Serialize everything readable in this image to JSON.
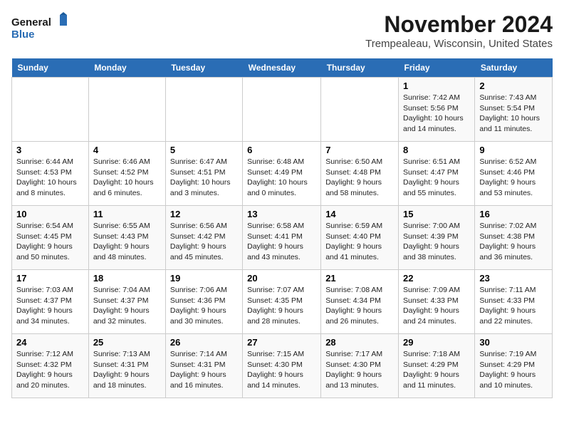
{
  "logo": {
    "line1": "General",
    "line2": "Blue"
  },
  "title": "November 2024",
  "location": "Trempealeau, Wisconsin, United States",
  "days_of_week": [
    "Sunday",
    "Monday",
    "Tuesday",
    "Wednesday",
    "Thursday",
    "Friday",
    "Saturday"
  ],
  "weeks": [
    [
      {
        "day": "",
        "info": ""
      },
      {
        "day": "",
        "info": ""
      },
      {
        "day": "",
        "info": ""
      },
      {
        "day": "",
        "info": ""
      },
      {
        "day": "",
        "info": ""
      },
      {
        "day": "1",
        "info": "Sunrise: 7:42 AM\nSunset: 5:56 PM\nDaylight: 10 hours and 14 minutes."
      },
      {
        "day": "2",
        "info": "Sunrise: 7:43 AM\nSunset: 5:54 PM\nDaylight: 10 hours and 11 minutes."
      }
    ],
    [
      {
        "day": "3",
        "info": "Sunrise: 6:44 AM\nSunset: 4:53 PM\nDaylight: 10 hours and 8 minutes."
      },
      {
        "day": "4",
        "info": "Sunrise: 6:46 AM\nSunset: 4:52 PM\nDaylight: 10 hours and 6 minutes."
      },
      {
        "day": "5",
        "info": "Sunrise: 6:47 AM\nSunset: 4:51 PM\nDaylight: 10 hours and 3 minutes."
      },
      {
        "day": "6",
        "info": "Sunrise: 6:48 AM\nSunset: 4:49 PM\nDaylight: 10 hours and 0 minutes."
      },
      {
        "day": "7",
        "info": "Sunrise: 6:50 AM\nSunset: 4:48 PM\nDaylight: 9 hours and 58 minutes."
      },
      {
        "day": "8",
        "info": "Sunrise: 6:51 AM\nSunset: 4:47 PM\nDaylight: 9 hours and 55 minutes."
      },
      {
        "day": "9",
        "info": "Sunrise: 6:52 AM\nSunset: 4:46 PM\nDaylight: 9 hours and 53 minutes."
      }
    ],
    [
      {
        "day": "10",
        "info": "Sunrise: 6:54 AM\nSunset: 4:45 PM\nDaylight: 9 hours and 50 minutes."
      },
      {
        "day": "11",
        "info": "Sunrise: 6:55 AM\nSunset: 4:43 PM\nDaylight: 9 hours and 48 minutes."
      },
      {
        "day": "12",
        "info": "Sunrise: 6:56 AM\nSunset: 4:42 PM\nDaylight: 9 hours and 45 minutes."
      },
      {
        "day": "13",
        "info": "Sunrise: 6:58 AM\nSunset: 4:41 PM\nDaylight: 9 hours and 43 minutes."
      },
      {
        "day": "14",
        "info": "Sunrise: 6:59 AM\nSunset: 4:40 PM\nDaylight: 9 hours and 41 minutes."
      },
      {
        "day": "15",
        "info": "Sunrise: 7:00 AM\nSunset: 4:39 PM\nDaylight: 9 hours and 38 minutes."
      },
      {
        "day": "16",
        "info": "Sunrise: 7:02 AM\nSunset: 4:38 PM\nDaylight: 9 hours and 36 minutes."
      }
    ],
    [
      {
        "day": "17",
        "info": "Sunrise: 7:03 AM\nSunset: 4:37 PM\nDaylight: 9 hours and 34 minutes."
      },
      {
        "day": "18",
        "info": "Sunrise: 7:04 AM\nSunset: 4:37 PM\nDaylight: 9 hours and 32 minutes."
      },
      {
        "day": "19",
        "info": "Sunrise: 7:06 AM\nSunset: 4:36 PM\nDaylight: 9 hours and 30 minutes."
      },
      {
        "day": "20",
        "info": "Sunrise: 7:07 AM\nSunset: 4:35 PM\nDaylight: 9 hours and 28 minutes."
      },
      {
        "day": "21",
        "info": "Sunrise: 7:08 AM\nSunset: 4:34 PM\nDaylight: 9 hours and 26 minutes."
      },
      {
        "day": "22",
        "info": "Sunrise: 7:09 AM\nSunset: 4:33 PM\nDaylight: 9 hours and 24 minutes."
      },
      {
        "day": "23",
        "info": "Sunrise: 7:11 AM\nSunset: 4:33 PM\nDaylight: 9 hours and 22 minutes."
      }
    ],
    [
      {
        "day": "24",
        "info": "Sunrise: 7:12 AM\nSunset: 4:32 PM\nDaylight: 9 hours and 20 minutes."
      },
      {
        "day": "25",
        "info": "Sunrise: 7:13 AM\nSunset: 4:31 PM\nDaylight: 9 hours and 18 minutes."
      },
      {
        "day": "26",
        "info": "Sunrise: 7:14 AM\nSunset: 4:31 PM\nDaylight: 9 hours and 16 minutes."
      },
      {
        "day": "27",
        "info": "Sunrise: 7:15 AM\nSunset: 4:30 PM\nDaylight: 9 hours and 14 minutes."
      },
      {
        "day": "28",
        "info": "Sunrise: 7:17 AM\nSunset: 4:30 PM\nDaylight: 9 hours and 13 minutes."
      },
      {
        "day": "29",
        "info": "Sunrise: 7:18 AM\nSunset: 4:29 PM\nDaylight: 9 hours and 11 minutes."
      },
      {
        "day": "30",
        "info": "Sunrise: 7:19 AM\nSunset: 4:29 PM\nDaylight: 9 hours and 10 minutes."
      }
    ]
  ]
}
